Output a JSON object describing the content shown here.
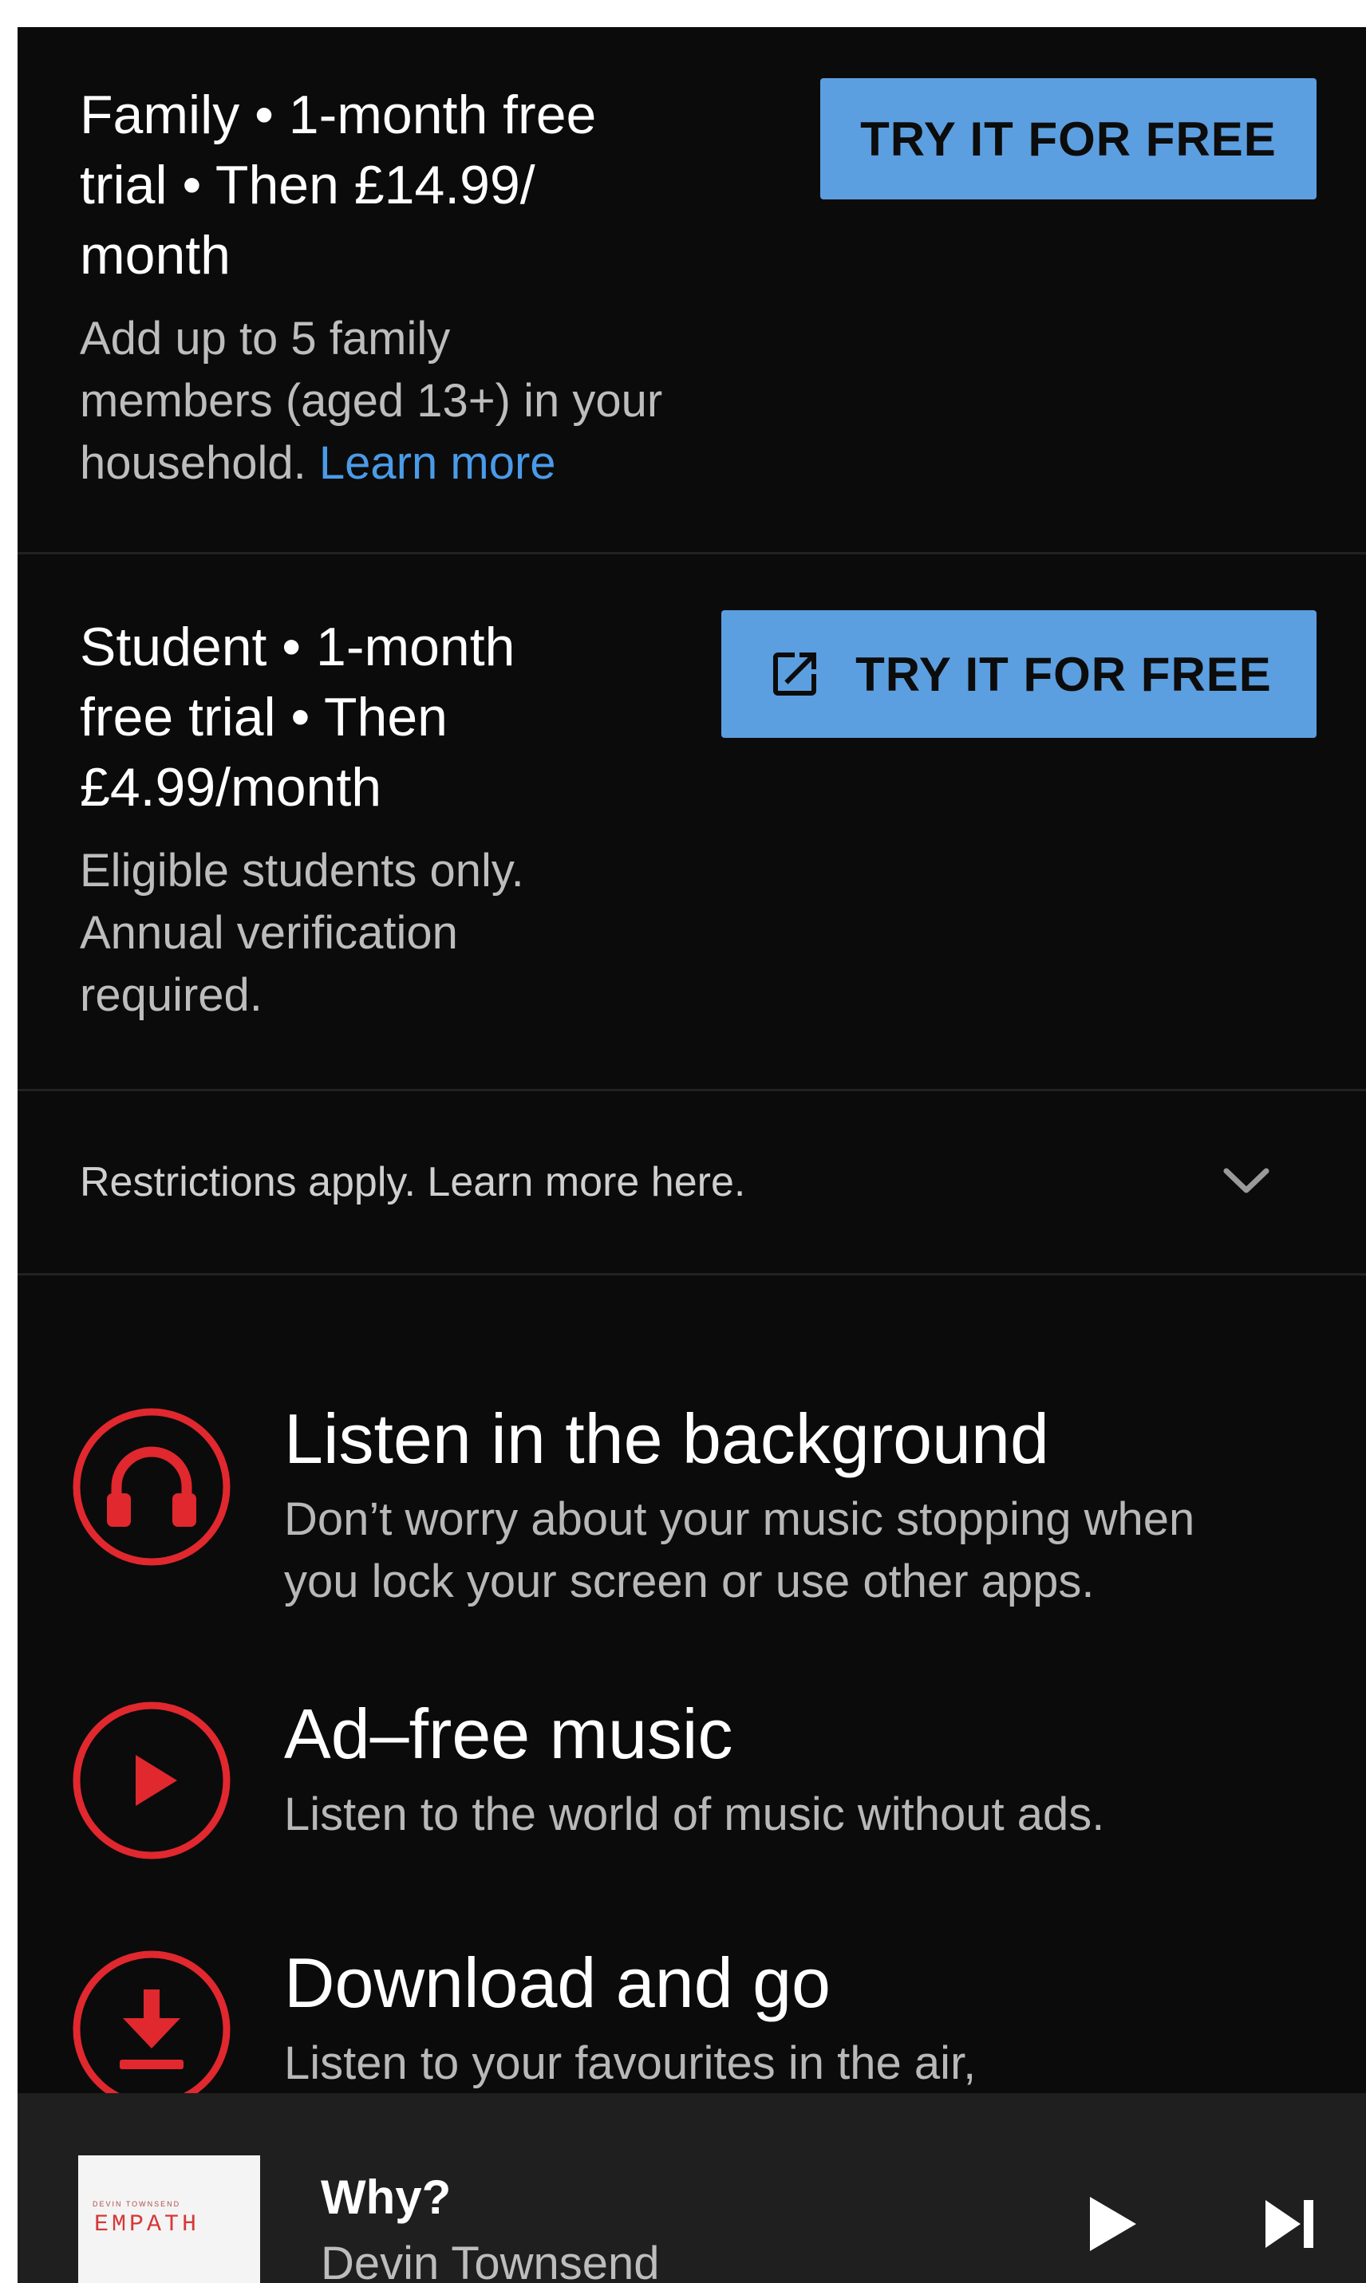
{
  "plans": [
    {
      "title_lines": [
        "Family • 1-month free",
        "trial • Then £14.99/",
        "month"
      ],
      "desc_lines": [
        "Add up to 5 family",
        "members (aged 13+) in your",
        "household. "
      ],
      "link": "Learn more",
      "button": "TRY IT FOR FREE"
    },
    {
      "title_lines": [
        "Student • 1-month",
        "free trial • Then",
        "£4.99/month"
      ],
      "desc_lines": [
        "Eligible students only.",
        "Annual verification",
        "required."
      ],
      "button": "TRY IT FOR FREE",
      "button_icon": "open-in-new-icon"
    }
  ],
  "restrictions": {
    "text": "Restrictions apply. Learn more here.",
    "icon": "chevron-down-icon"
  },
  "features": [
    {
      "icon": "headphones-icon",
      "title": "Listen in the background",
      "desc_lines": [
        "Don’t worry about your music stopping when",
        "you lock your screen or use other apps."
      ]
    },
    {
      "icon": "play-icon",
      "title": "Ad–free music",
      "desc_lines": [
        "Listen to the world of music without ads."
      ]
    },
    {
      "icon": "download-icon",
      "title": "Download and go",
      "desc_lines": [
        "Listen to your favourites in the air,"
      ]
    }
  ],
  "player": {
    "title": "Why?",
    "artist": "Devin Townsend",
    "album_art_band": "DEVIN TOWNSEND",
    "album_art_name": "EMPATH",
    "play_icon": "play-icon",
    "next_icon": "skip-next-icon"
  },
  "colors": {
    "background": "#0b0b0b",
    "button": "#5c9fe0",
    "link": "#4a9be8",
    "accent_red": "#e0282e",
    "player_bar": "#1f1f1f"
  }
}
